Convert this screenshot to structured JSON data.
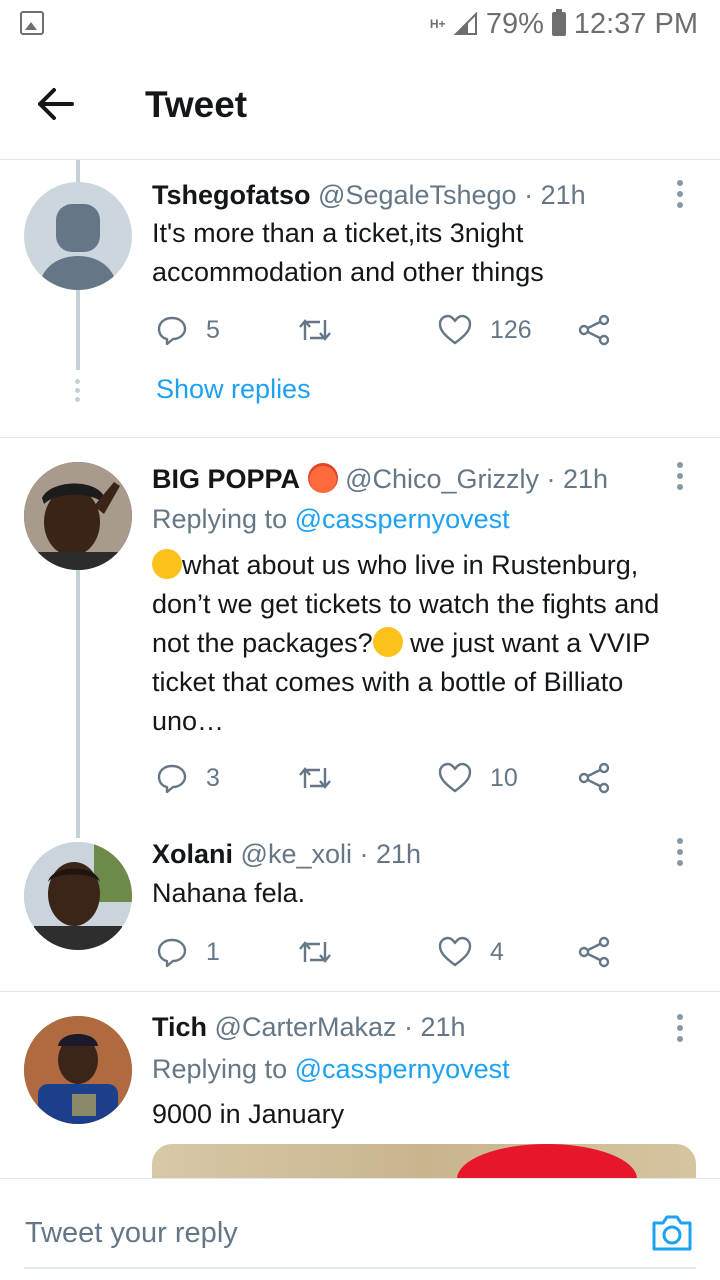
{
  "status_bar": {
    "network": "H+",
    "battery": "79%",
    "time": "12:37 PM",
    "icons": [
      "image-notification-icon",
      "signal-icon",
      "battery-icon"
    ]
  },
  "header": {
    "title": "Tweet",
    "back_icon": "arrow-left-icon"
  },
  "tweets": [
    {
      "name": "Tshegofatso",
      "handle": "@SegaleTshego",
      "time": "· 21h",
      "text": "It's more than a ticket,its 3night accommodation and other things",
      "replies": "5",
      "retweets": "",
      "likes": "126",
      "show_replies": "Show replies"
    },
    {
      "name": "BIG POPPA",
      "name_emoji": "smiling-devil-emoji",
      "handle": "@Chico_Grizzly",
      "time": "· 21h",
      "replying_to_prefix": "Replying to",
      "replying_to_handle": "@casspernyovest",
      "text_part1": "what about us who live in Rustenburg, don’t we get tickets to watch the fights and not the packages?",
      "text_part2": " we just want a VVIP ticket that comes with a bottle of Billiato uno…",
      "text_emoji": "loudly-crying-face-emoji",
      "replies": "3",
      "retweets": "",
      "likes": "10"
    },
    {
      "name": "Xolani",
      "handle": "@ke_xoli",
      "time": "· 21h",
      "text": "Nahana fela.",
      "replies": "1",
      "retweets": "",
      "likes": "4"
    },
    {
      "name": "Tich",
      "handle": "@CarterMakaz",
      "time": "· 21h",
      "replying_to_prefix": "Replying to",
      "replying_to_handle": "@casspernyovest",
      "text": "9000 in January"
    }
  ],
  "reply_bar": {
    "placeholder": "Tweet your reply",
    "camera_icon": "camera-icon"
  },
  "colors": {
    "link": "#1da1f2",
    "secondary_text": "#657786",
    "primary_text": "#14171a",
    "divider": "#e1e8ed",
    "thread_line": "#c4cfd6"
  }
}
